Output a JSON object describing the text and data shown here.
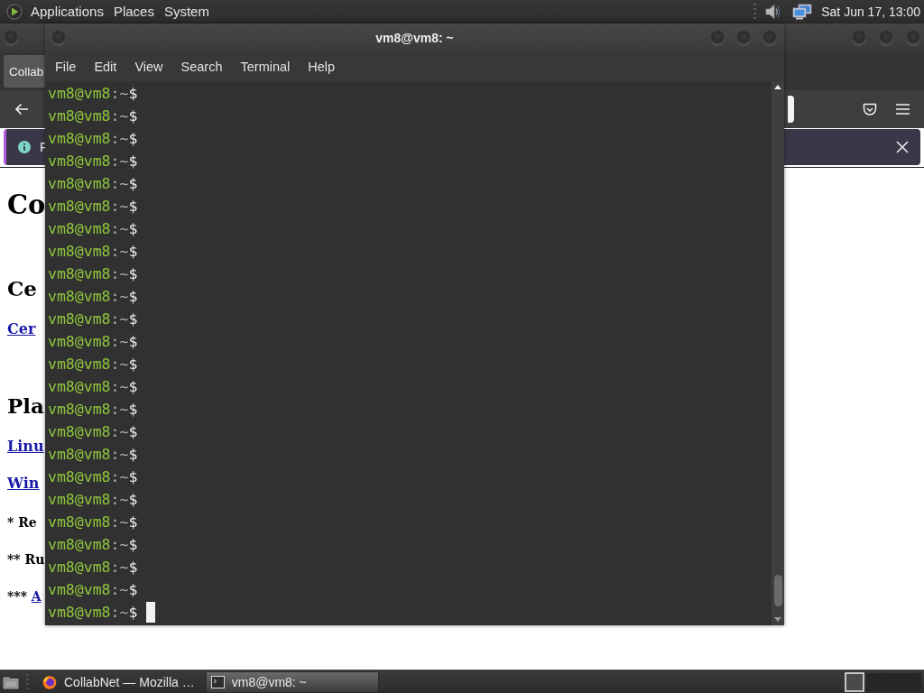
{
  "top_panel": {
    "menus": [
      "Applications",
      "Places",
      "System"
    ],
    "clock": "Sat Jun 17, 13:00"
  },
  "browser": {
    "tab": "Collab",
    "notification": "F",
    "page": [
      {
        "kind": "h1",
        "text": "Co"
      },
      {
        "kind": "h2",
        "text": "Ce"
      },
      {
        "kind": "link",
        "text": "Cer"
      },
      {
        "kind": "h2",
        "text": "Pla"
      },
      {
        "kind": "link",
        "text": "Linu"
      },
      {
        "kind": "link",
        "text": "Win"
      },
      {
        "kind": "note",
        "text": "* Re"
      },
      {
        "kind": "note",
        "text": "** Ru"
      },
      {
        "kind": "note",
        "text": "***",
        "link": "A"
      }
    ]
  },
  "terminal": {
    "title": "vm8@vm8: ~",
    "menu": [
      "File",
      "Edit",
      "View",
      "Search",
      "Terminal",
      "Help"
    ],
    "cursor": true,
    "lines": [
      {
        "user": "vm8@vm8",
        "path": ":~",
        "sign": "$"
      },
      {
        "user": "vm8@vm8",
        "path": ":~",
        "sign": "$"
      },
      {
        "user": "vm8@vm8",
        "path": ":~",
        "sign": "$"
      },
      {
        "user": "vm8@vm8",
        "path": ":~",
        "sign": "$"
      },
      {
        "user": "vm8@vm8",
        "path": ":~",
        "sign": "$"
      },
      {
        "user": "vm8@vm8",
        "path": ":~",
        "sign": "$"
      },
      {
        "user": "vm8@vm8",
        "path": ":~",
        "sign": "$"
      },
      {
        "user": "vm8@vm8",
        "path": ":~",
        "sign": "$"
      },
      {
        "user": "vm8@vm8",
        "path": ":~",
        "sign": "$"
      },
      {
        "user": "vm8@vm8",
        "path": ":~",
        "sign": "$"
      },
      {
        "user": "vm8@vm8",
        "path": ":~",
        "sign": "$"
      },
      {
        "user": "vm8@vm8",
        "path": ":~",
        "sign": "$"
      },
      {
        "user": "vm8@vm8",
        "path": ":~",
        "sign": "$"
      },
      {
        "user": "vm8@vm8",
        "path": ":~",
        "sign": "$"
      },
      {
        "user": "vm8@vm8",
        "path": ":~",
        "sign": "$"
      },
      {
        "user": "vm8@vm8",
        "path": ":~",
        "sign": "$"
      },
      {
        "user": "vm8@vm8",
        "path": ":~",
        "sign": "$"
      },
      {
        "user": "vm8@vm8",
        "path": ":~",
        "sign": "$"
      },
      {
        "user": "vm8@vm8",
        "path": ":~",
        "sign": "$"
      },
      {
        "user": "vm8@vm8",
        "path": ":~",
        "sign": "$"
      },
      {
        "user": "vm8@vm8",
        "path": ":~",
        "sign": "$"
      },
      {
        "user": "vm8@vm8",
        "path": ":~",
        "sign": "$"
      },
      {
        "user": "vm8@vm8",
        "path": ":~",
        "sign": "$"
      },
      {
        "user": "vm8@vm8",
        "path": ":~",
        "sign": "$"
      }
    ]
  },
  "taskbar": {
    "tasks": [
      {
        "label": "CollabNet — Mozilla …",
        "kind": "browser",
        "selected": false
      },
      {
        "label": "vm8@vm8: ~",
        "kind": "terminal",
        "selected": true
      }
    ]
  }
}
